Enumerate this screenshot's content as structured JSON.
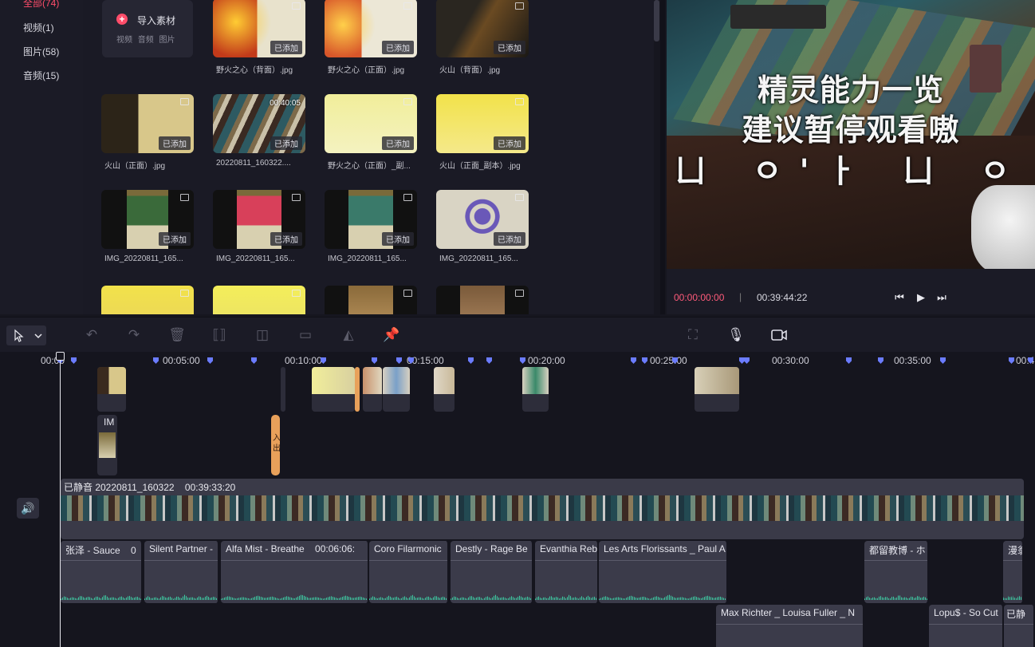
{
  "library_nav": {
    "items": [
      {
        "label": "全部(74)",
        "active": true
      },
      {
        "label": "视频(1)",
        "active": false
      },
      {
        "label": "图片(58)",
        "active": false
      },
      {
        "label": "音频(15)",
        "active": false
      }
    ]
  },
  "import": {
    "title": "导入素材",
    "types": "视频 音频 图片"
  },
  "media": {
    "added_label": "已添加",
    "items": [
      {
        "name": "野火之心（背面）.jpg",
        "kind": "image"
      },
      {
        "name": "野火之心（正面）.jpg",
        "kind": "image"
      },
      {
        "name": "火山（背面）.jpg",
        "kind": "image"
      },
      {
        "name": "火山（正面）.jpg",
        "kind": "image"
      },
      {
        "name": "20220811_160322....",
        "kind": "video",
        "duration": "00:40:05"
      },
      {
        "name": "野火之心（正面）_副...",
        "kind": "image"
      },
      {
        "name": "火山（正面_副本）.jpg",
        "kind": "image"
      },
      {
        "name": "IMG_20220811_165...",
        "kind": "image"
      },
      {
        "name": "IMG_20220811_165...",
        "kind": "image"
      },
      {
        "name": "IMG_20220811_165...",
        "kind": "image"
      },
      {
        "name": "IMG_20220811_165...",
        "kind": "image"
      }
    ]
  },
  "preview": {
    "subtitle_line1": "精灵能力一览",
    "subtitle_line2": "建议暂停观看嗷",
    "subtitle_line3": "ㄩ ㅇ'ㅏ ㄩ ㅇ",
    "current_time": "00:00:00:00",
    "separator": "|",
    "total_time": "00:39:44:22"
  },
  "timeline": {
    "ruler_labels": [
      "00:00",
      "00:05:00",
      "00:10:00",
      "00:15:00",
      "00:20:00",
      "00:25:00",
      "00:30:00",
      "00:35:00",
      "00:4"
    ],
    "overlay_clip_label": "IM",
    "transition_label": "入出",
    "main_track_label": "已静音 20220811_160322",
    "main_track_duration": "00:39:33:20",
    "audio_clips": [
      "张泽 - Sauce",
      "Silent Partner - ",
      "Alfa Mist - Breathe",
      "Coro Filarmonic",
      "Destly - Rage Be",
      "Evanthia Reb",
      "Les Arts Florissants _ Paul A",
      "都留教博 - ホ",
      "漫翁",
      "Max Richter _ Louisa Fuller _ N",
      "Lopu$ - So Cut",
      "已静"
    ],
    "audio_extra": {
      "clip0_tail": "0",
      "clip2_time": "00:06:06:"
    }
  },
  "icons": {
    "select": "cursor-arrow",
    "undo": "undo",
    "redo": "redo",
    "delete": "trash",
    "split": "split",
    "crop": "crop",
    "freeze": "freeze-frame",
    "mirror": "mirror",
    "pin": "pin",
    "screenshot": "screenshot",
    "record_voice": "microphone",
    "record_video": "camera"
  }
}
